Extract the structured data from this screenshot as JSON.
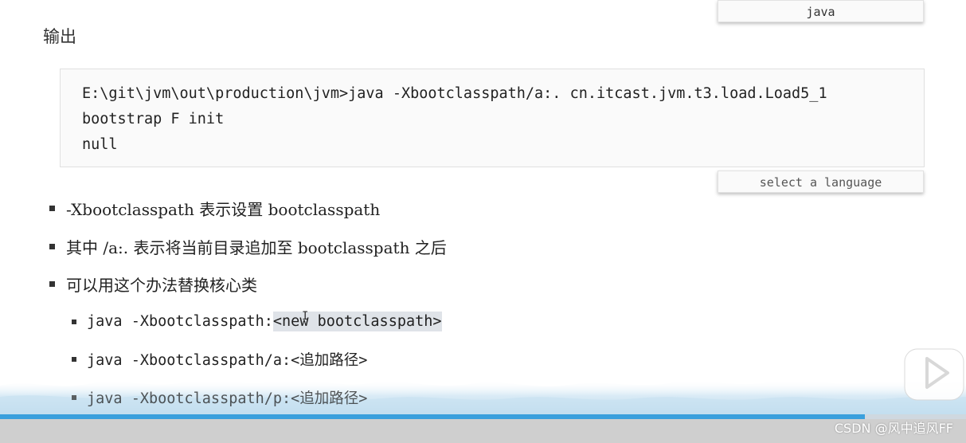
{
  "heading": "输出",
  "language_tab_top": "java",
  "language_tab_bottom": "select a language",
  "code_lines": [
    "E:\\git\\jvm\\out\\production\\jvm>java -Xbootclasspath/a:. cn.itcast.jvm.t3.load.Load5_1",
    "bootstrap F init",
    "null"
  ],
  "bullets": [
    "-Xbootclasspath 表示设置 bootclasspath",
    "其中 /a:. 表示将当前目录追加至 bootclasspath 之后",
    "可以用这个办法替换核心类"
  ],
  "sub_bullets": {
    "item0_prefix": "java -Xbootclasspath:",
    "item0_highlight": "<new bootclasspath>",
    "item1": "java -Xbootclasspath/a:<追加路径>",
    "item2": "java -Xbootclasspath/p:<追加路径>"
  },
  "watermark": "CSDN @风中追风FF",
  "progress_fraction": 0.895,
  "colors": {
    "progress": "#3aa0dd",
    "wave": "#bfdcef",
    "highlight": "#dfe3e8"
  },
  "icons": {
    "play": "play-icon",
    "cursor": "text-cursor-icon"
  }
}
